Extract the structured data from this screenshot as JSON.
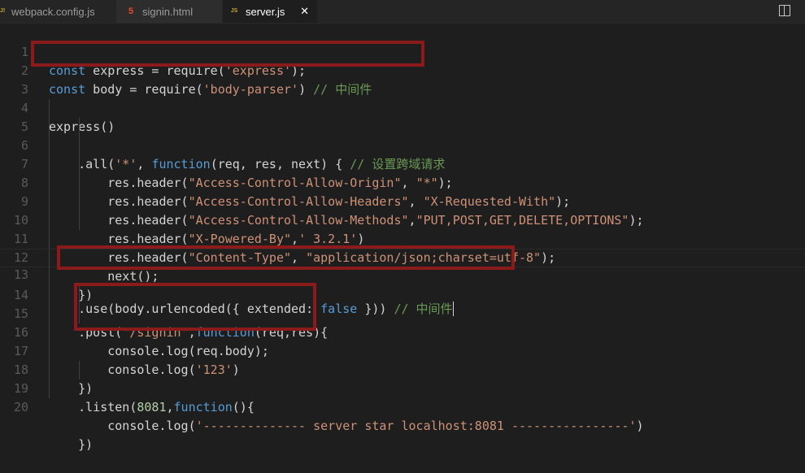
{
  "tabs": [
    {
      "name": "webpack.config.js",
      "icon": "js-icon",
      "active": false
    },
    {
      "name": "signin.html",
      "icon": "html5-icon",
      "active": false
    },
    {
      "name": "server.js",
      "icon": "js-icon",
      "active": true,
      "close": "✕"
    }
  ],
  "colors": {
    "background": "#1e1e1e",
    "keyword": "#569cd6",
    "string": "#ce9178",
    "comment": "#6a9955",
    "number": "#b5cea8",
    "highlight_box": "#8b1a1a"
  },
  "editor": {
    "lines": [
      {
        "n": "1",
        "t": "const express = require('express');"
      },
      {
        "n": "2",
        "t": "const body = require('body-parser') // 中间件"
      },
      {
        "n": "3",
        "t": ""
      },
      {
        "n": "4",
        "t": "express()"
      },
      {
        "n": "5",
        "t": "    .all('*', function(req, res, next) { // 设置跨域请求"
      },
      {
        "n": "6",
        "t": "        res.header(\"Access-Control-Allow-Origin\", \"*\");"
      },
      {
        "n": "7",
        "t": "        res.header(\"Access-Control-Allow-Headers\", \"X-Requested-With\");"
      },
      {
        "n": "8",
        "t": "        res.header(\"Access-Control-Allow-Methods\",\"PUT,POST,GET,DELETE,OPTIONS\");"
      },
      {
        "n": "9",
        "t": "        res.header(\"X-Powered-By\",' 3.2.1')"
      },
      {
        "n": "10",
        "t": "        res.header(\"Content-Type\", \"application/json;charset=utf-8\");"
      },
      {
        "n": "11",
        "t": "        next();"
      },
      {
        "n": "12",
        "t": "    })"
      },
      {
        "n": "13",
        "t": "    .use(body.urlencoded({ extended: false })) // 中间件"
      },
      {
        "n": "14",
        "t": "    .post('/signin',function(req,res){"
      },
      {
        "n": "15",
        "t": "        console.log(req.body);"
      },
      {
        "n": "16",
        "t": "        console.log('123')"
      },
      {
        "n": "17",
        "t": "    })"
      },
      {
        "n": "18",
        "t": "    .listen(8081,function(){"
      },
      {
        "n": "19",
        "t": "        console.log('-------------- server star localhost:8081 ----------------')"
      },
      {
        "n": "20",
        "t": "    })"
      }
    ]
  }
}
